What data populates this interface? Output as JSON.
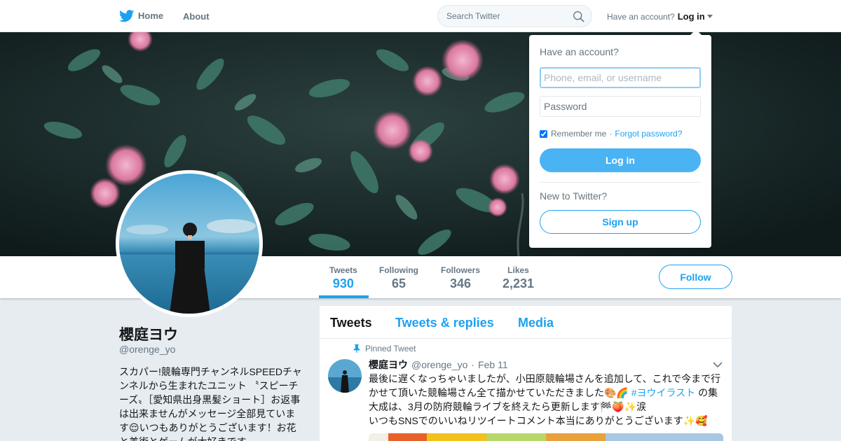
{
  "nav": {
    "home_label": "Home",
    "about_label": "About",
    "search_placeholder": "Search Twitter",
    "have_account_text": "Have an account?",
    "login_label": "Log in"
  },
  "profile": {
    "name": "櫻庭ヨウ",
    "handle": "@orenge_yo",
    "bio": "スカパー!競輪専門チャンネルSPEEDチャンネルから生まれたユニット 〝スピーチーズ〟［愛知県出身黒髪ショート］お返事は出来ませんがメッセージ全部見ています😌いつもありがとうございます！お花と美術とゲームが大好きです",
    "follow_label": "Follow"
  },
  "stats": [
    {
      "label": "Tweets",
      "value": "930",
      "active": true
    },
    {
      "label": "Following",
      "value": "65",
      "active": false
    },
    {
      "label": "Followers",
      "value": "346",
      "active": false
    },
    {
      "label": "Likes",
      "value": "2,231",
      "active": false
    }
  ],
  "timeline": {
    "tabs": [
      "Tweets",
      "Tweets & replies",
      "Media"
    ],
    "pinned_label": "Pinned Tweet",
    "tweet": {
      "author": "櫻庭ヨウ",
      "handle": "@orenge_yo",
      "separator": "·",
      "date": "Feb 11",
      "text_before": "最後に遅くなっちゃいましたが、小田原競輪場さんを追加して、これで今まで行かせて頂いた競輪場さん全て描かせていただきました🎨🌈 ",
      "hashtag": "#ヨウイラスト",
      "text_after": " の集大成は、3月の防府競輪ライブを終えたら更新します🏁🍑✨涙",
      "text_line2": "いつもSNSでのいいねリツイートコメント本当にありがとうございます✨🥰"
    }
  },
  "login_dropdown": {
    "title": "Have an account?",
    "username_placeholder": "Phone, email, or username",
    "password_placeholder": "Password",
    "remember_label": "Remember me",
    "separator": "·",
    "forgot_label": "Forgot password?",
    "login_button": "Log in",
    "new_to_twitter": "New to Twitter?",
    "signup_button": "Sign up"
  },
  "colors": {
    "brand_blue": "#1da1f2",
    "login_button": "#4ab3f4",
    "background": "#e6ecf0"
  },
  "icons": {
    "logo": "twitter-bird-icon",
    "search": "search-icon",
    "pin": "pin-icon",
    "caret": "caret-down-icon",
    "chevron": "chevron-down-icon"
  }
}
